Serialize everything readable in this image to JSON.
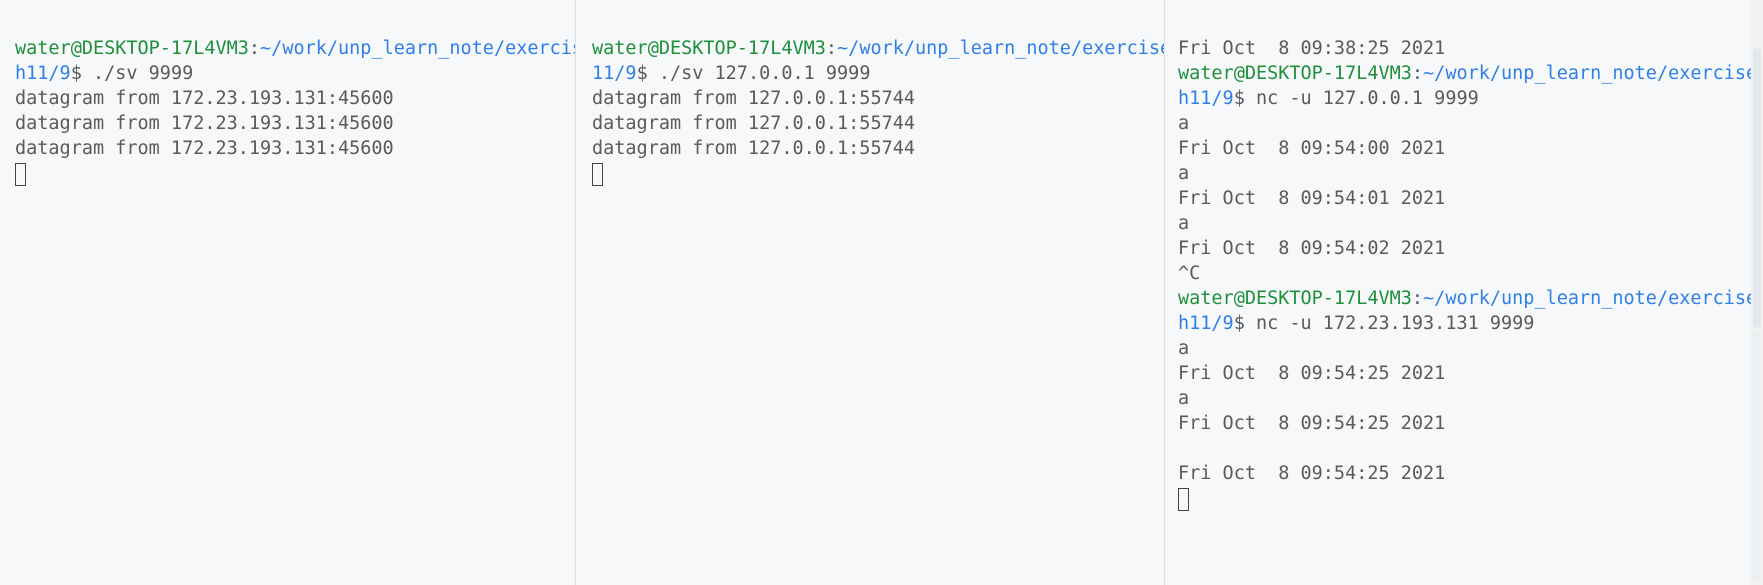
{
  "panes": [
    {
      "lines": [
        {
          "user": "water@DESKTOP-17L4VM3",
          "sep": ":",
          "path": "~/work/unp_learn_note/exercise/c"
        },
        {
          "path": "h11/9",
          "cmd": "$ ./sv 9999"
        },
        {
          "text": "datagram from 172.23.193.131:45600"
        },
        {
          "text": "datagram from 172.23.193.131:45600"
        },
        {
          "text": "datagram from 172.23.193.131:45600"
        }
      ]
    },
    {
      "lines": [
        {
          "user": "water@DESKTOP-17L4VM3",
          "sep": ":",
          "path": "~/work/unp_learn_note/exercise/ch"
        },
        {
          "path": "11/9",
          "cmd": "$ ./sv 127.0.0.1 9999"
        },
        {
          "text": "datagram from 127.0.0.1:55744"
        },
        {
          "text": "datagram from 127.0.0.1:55744"
        },
        {
          "text": "datagram from 127.0.0.1:55744"
        }
      ]
    },
    {
      "lines": [
        {
          "text": "Fri Oct  8 09:38:25 2021"
        },
        {
          "user": "water@DESKTOP-17L4VM3",
          "sep": ":",
          "path": "~/work/unp_learn_note/exercise/c"
        },
        {
          "path": "h11/9",
          "cmd": "$ nc -u 127.0.0.1 9999"
        },
        {
          "text": "a"
        },
        {
          "text": "Fri Oct  8 09:54:00 2021"
        },
        {
          "text": "a"
        },
        {
          "text": "Fri Oct  8 09:54:01 2021"
        },
        {
          "text": "a"
        },
        {
          "text": "Fri Oct  8 09:54:02 2021"
        },
        {
          "text": "^C"
        },
        {
          "user": "water@DESKTOP-17L4VM3",
          "sep": ":",
          "path": "~/work/unp_learn_note/exercise/c"
        },
        {
          "path": "h11/9",
          "cmd": "$ nc -u 172.23.193.131 9999"
        },
        {
          "text": "a"
        },
        {
          "text": "Fri Oct  8 09:54:25 2021"
        },
        {
          "text": "a"
        },
        {
          "text": "Fri Oct  8 09:54:25 2021"
        },
        {
          "text": ""
        },
        {
          "text": "Fri Oct  8 09:54:25 2021"
        }
      ]
    }
  ],
  "colors": {
    "background": "#f6f8fa",
    "user": "#1f8f3a",
    "path": "#2f7fe6",
    "text": "#5a5a5a"
  }
}
